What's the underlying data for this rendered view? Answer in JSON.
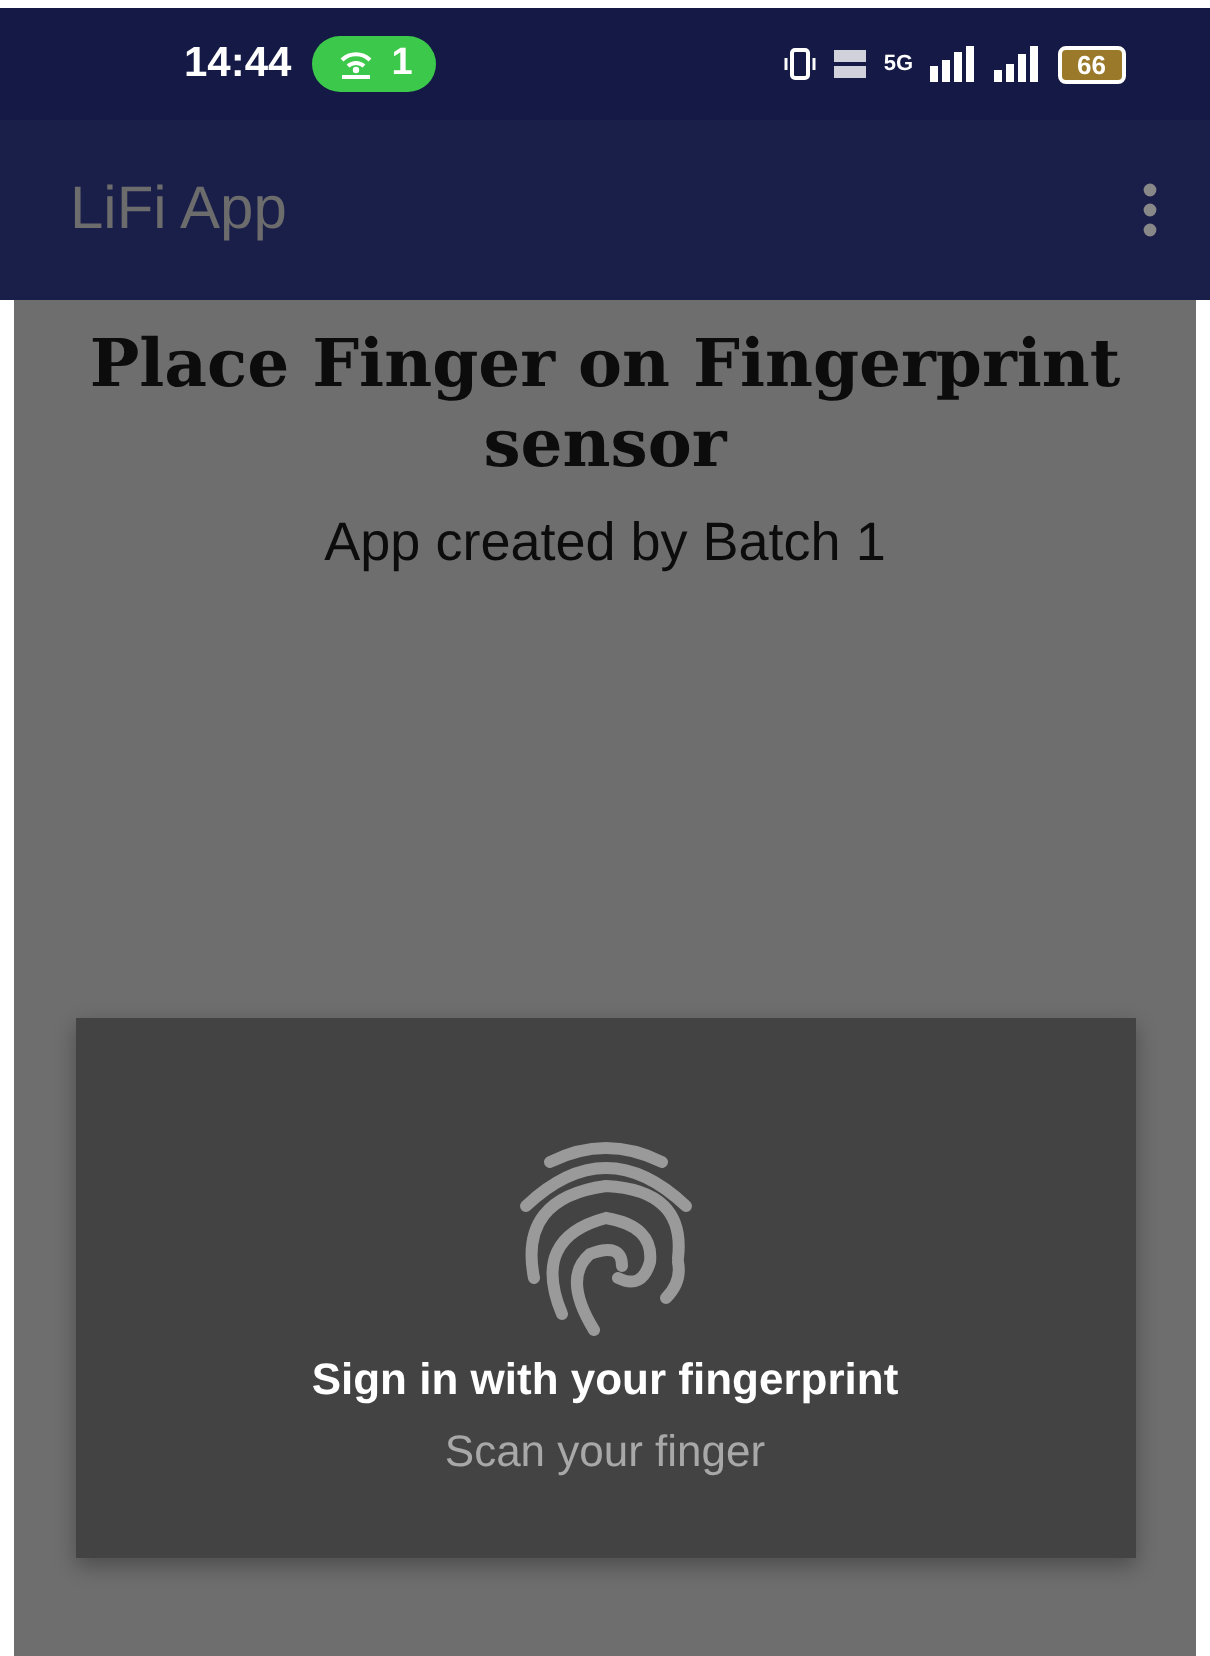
{
  "status_bar": {
    "time": "14:44",
    "hotspot_count": "1",
    "network": "5G",
    "battery": "66"
  },
  "app_bar": {
    "title": "LiFi App"
  },
  "content": {
    "heading": "Place Finger on Fingerprint sensor",
    "subtitle": "App created by Batch 1"
  },
  "dialog": {
    "title": "Sign in with your fingerprint",
    "message": "Scan your finger"
  }
}
